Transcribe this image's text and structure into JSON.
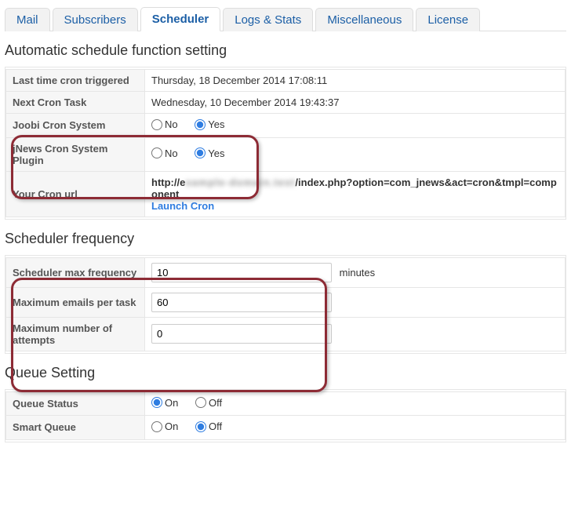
{
  "tabs": {
    "mail": "Mail",
    "subscribers": "Subscribers",
    "scheduler": "Scheduler",
    "logs": "Logs & Stats",
    "misc": "Miscellaneous",
    "license": "License"
  },
  "section1": {
    "title": "Automatic schedule function setting",
    "last_cron_label": "Last time cron triggered",
    "last_cron_value": "Thursday, 18 December 2014 17:08:11",
    "next_cron_label": "Next Cron Task",
    "next_cron_value": "Wednesday, 10 December 2014 19:43:37",
    "joobi_label": "Joobi Cron System",
    "jnews_label": "jNews Cron System Plugin",
    "opt_no": "No",
    "opt_yes": "Yes",
    "joobi_value": "Yes",
    "jnews_value": "Yes",
    "cron_url_label": "Your Cron url",
    "cron_url_prefix": "http://e",
    "cron_url_blurred": "xample-domain.test",
    "cron_url_suffix": "/index.php?option=com_jnews&act=cron&tmpl=component",
    "launch_cron": "Launch Cron"
  },
  "section2": {
    "title": "Scheduler frequency",
    "max_freq_label": "Scheduler max frequency",
    "max_freq_value": "10",
    "max_freq_hint": "minutes",
    "max_emails_label": "Maximum emails per task",
    "max_emails_value": "60",
    "max_attempts_label": "Maximum number of attempts",
    "max_attempts_value": "0"
  },
  "section3": {
    "title": "Queue Setting",
    "queue_status_label": "Queue Status",
    "smart_queue_label": "Smart Queue",
    "opt_on": "On",
    "opt_off": "Off",
    "queue_status_value": "On",
    "smart_queue_value": "Off"
  }
}
